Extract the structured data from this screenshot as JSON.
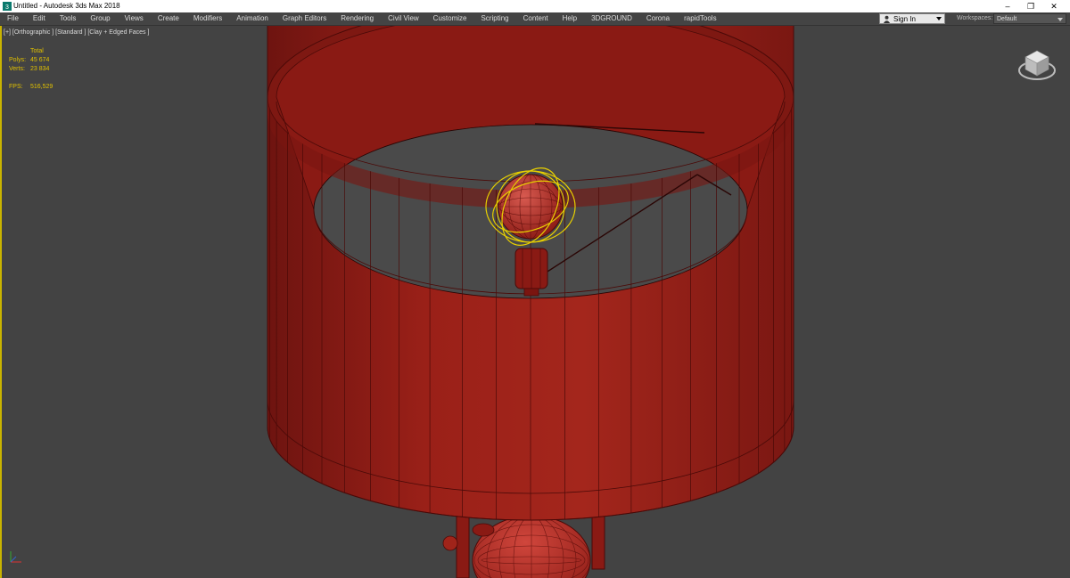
{
  "window": {
    "title": "Untitled - Autodesk 3ds Max 2018",
    "controls": {
      "minimize": "–",
      "maximize": "❐",
      "close": "✕"
    }
  },
  "menu": {
    "items": [
      "File",
      "Edit",
      "Tools",
      "Group",
      "Views",
      "Create",
      "Modifiers",
      "Animation",
      "Graph Editors",
      "Rendering",
      "Civil View",
      "Customize",
      "Scripting",
      "Content",
      "Help",
      "3DGROUND",
      "Corona",
      "rapidTools"
    ],
    "sign_in": "Sign In",
    "workspaces_label": "Workspaces:",
    "workspaces_value": "Default"
  },
  "viewport": {
    "label": "[+] [Orthographic ] [Standard ] [Clay + Edged Faces ]",
    "stats": {
      "header": "Total",
      "polys_label": "Polys:",
      "polys_value": "45 674",
      "verts_label": "Verts:",
      "verts_value": "23 834",
      "fps_label": "FPS:",
      "fps_value": "516,529"
    }
  },
  "colors": {
    "viewport_bg": "#434343",
    "mesh_red": "#8a1a14",
    "mesh_edges": "#4a0a08",
    "selection_gizmo": "#e8d000",
    "stats_text": "#e0c000"
  },
  "icons": {
    "app": "3dsmax-app-icon",
    "user": "user-icon",
    "viewcube": "viewcube-icon",
    "axis": "axis-tripod-icon"
  }
}
